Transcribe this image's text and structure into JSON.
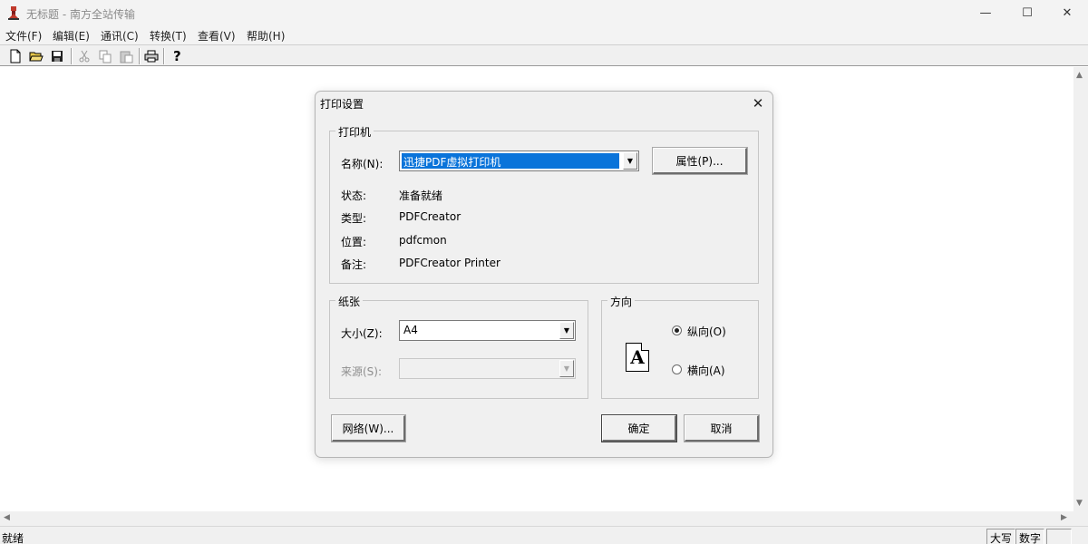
{
  "window": {
    "title": "无标题 - 南方全站传输",
    "min": "—",
    "max": "☐",
    "close": "✕"
  },
  "menu": [
    "文件(F)",
    "编辑(E)",
    "通讯(C)",
    "转换(T)",
    "查看(V)",
    "帮助(H)"
  ],
  "toolbar": {
    "icons": [
      "new-file-icon",
      "open-folder-icon",
      "save-icon",
      "cut-icon",
      "copy-icon",
      "paste-icon",
      "print-icon",
      "help-icon"
    ]
  },
  "dialog": {
    "title": "打印设置",
    "printer": {
      "group_label": "打印机",
      "name_label": "名称(N):",
      "name_value": "迅捷PDF虚拟打印机",
      "properties_button": "属性(P)...",
      "status_label": "状态:",
      "status_value": "准备就绪",
      "type_label": "类型:",
      "type_value": "PDFCreator",
      "location_label": "位置:",
      "location_value": "pdfcmon",
      "comment_label": "备注:",
      "comment_value": "PDFCreator Printer"
    },
    "paper": {
      "group_label": "纸张",
      "size_label": "大小(Z):",
      "size_value": "A4",
      "source_label": "来源(S):",
      "source_value": ""
    },
    "orientation": {
      "group_label": "方向",
      "portrait_label": "纵向(O)",
      "landscape_label": "横向(A)",
      "selected": "portrait",
      "icon_letter": "A"
    },
    "network_button": "网络(W)...",
    "ok_button": "确定",
    "cancel_button": "取消"
  },
  "statusbar": {
    "text": "就绪",
    "caps": "大写",
    "num": "数字",
    "scrl": ""
  }
}
